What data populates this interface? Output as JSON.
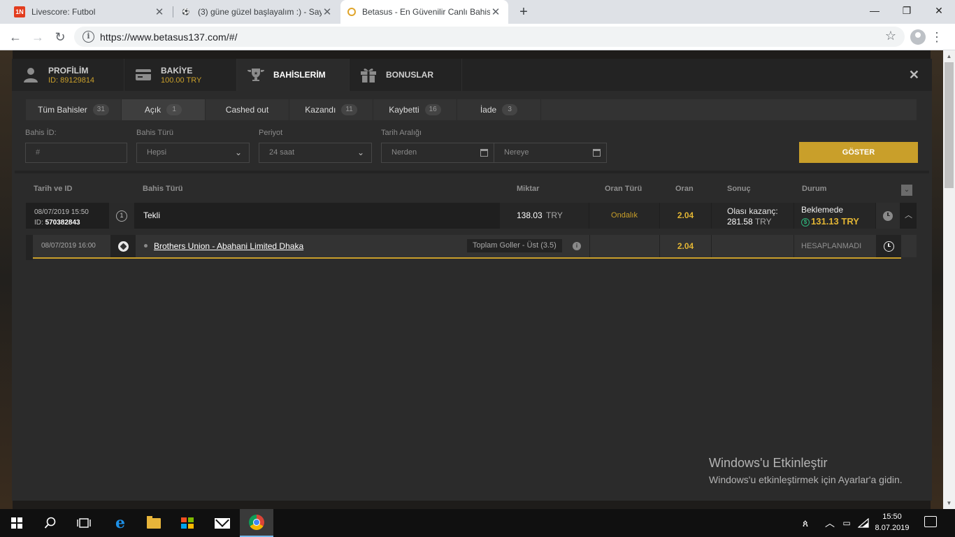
{
  "browser": {
    "tabs": [
      {
        "title": "Livescore: Futbol",
        "favicon": "1n-favicon",
        "active": false
      },
      {
        "title": "(3) güne güzel başlayalım :) - Say",
        "favicon": "football-favicon",
        "active": false
      },
      {
        "title": "Betasus - En Güvenilir Canlı Bahis",
        "favicon": "betasus-favicon",
        "active": true
      }
    ],
    "url": "https://www.betasus137.com/#/"
  },
  "nav": {
    "profile": {
      "label": "PROFİLİM",
      "sub": "ID: 89129814"
    },
    "balance": {
      "label": "BAKİYE",
      "sub": "100.00 TRY"
    },
    "bets": {
      "label": "BAHİSLERİM"
    },
    "bonus": {
      "label": "BONUSLAR"
    }
  },
  "filter_tabs": [
    {
      "label": "Tüm Bahisler",
      "count": "31"
    },
    {
      "label": "Açık",
      "count": "1"
    },
    {
      "label": "Cashed out",
      "count": ""
    },
    {
      "label": "Kazandı",
      "count": "11"
    },
    {
      "label": "Kaybetti",
      "count": "16"
    },
    {
      "label": "İade",
      "count": "3"
    }
  ],
  "filters": {
    "bet_id_label": "Bahis İD:",
    "bet_id_placeholder": "#",
    "bet_type_label": "Bahis Türü",
    "bet_type_value": "Hepsi",
    "period_label": "Periyot",
    "period_value": "24 saat",
    "date_range_label": "Tarih Aralığı",
    "from_placeholder": "Nerden",
    "to_placeholder": "Nereye",
    "show_button": "GÖSTER"
  },
  "table": {
    "headers": {
      "date_id": "Tarih ve ID",
      "bet_type": "Bahis Türü",
      "amount": "Miktar",
      "odds_type": "Oran Türü",
      "odds": "Oran",
      "result": "Sonuç",
      "status": "Durum"
    },
    "bet": {
      "date": "08/07/2019 15:50",
      "id_label": "ID:",
      "id": "570382843",
      "selection_count": "1",
      "type": "Tekli",
      "amount": "138.03",
      "currency": "TRY",
      "odds_type": "Ondalık",
      "odds": "2.04",
      "potential_label": "Olası kazanç:",
      "potential_amount": "281.58",
      "potential_currency": "TRY",
      "status": "Beklemede",
      "cashout": "131.13 TRY"
    },
    "selection": {
      "date": "08/07/2019 16:00",
      "match": "Brothers Union - Abahani Limited Dhaka",
      "market": "Toplam Goller - Üst (3.5)",
      "odds": "2.04",
      "status": "HESAPLANMADI"
    }
  },
  "watermark": {
    "title": "Windows'u Etkinleştir",
    "subtitle": "Windows'u etkinleştirmek için Ayarlar'a gidin."
  },
  "taskbar": {
    "time": "15:50",
    "date": "8.07.2019"
  },
  "colors": {
    "accent_gold": "#c99f2a",
    "odds_gold": "#e2b534",
    "cashout_green": "#2fb37a"
  }
}
